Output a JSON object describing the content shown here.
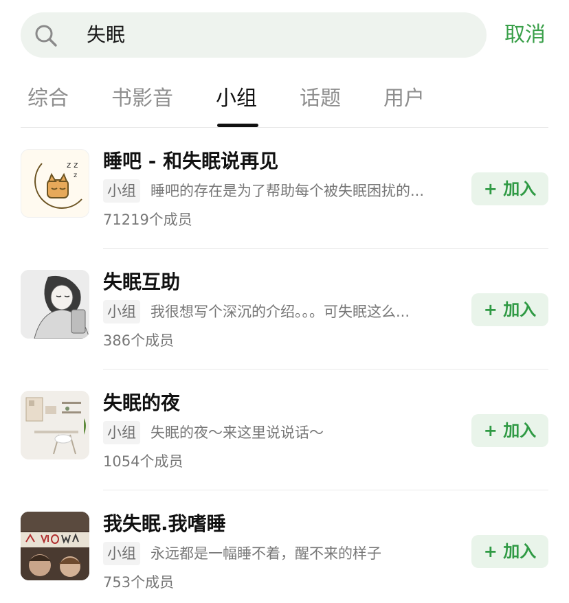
{
  "search": {
    "query": "失眠",
    "cancel_label": "取消"
  },
  "tabs": [
    {
      "label": "综合"
    },
    {
      "label": "书影音"
    },
    {
      "label": "小组"
    },
    {
      "label": "话题"
    },
    {
      "label": "用户"
    }
  ],
  "active_tab": "小组",
  "groups": [
    {
      "title": "睡吧 - 和失眠说再见",
      "tag": "小组",
      "description": "睡吧的存在是为了帮助每个被失眠困扰的...",
      "members": "71219个成员",
      "join_label": "+ 加入"
    },
    {
      "title": "失眠互助",
      "tag": "小组",
      "description": "我很想写个深沉的介绍。。。可失眠这么...",
      "members": "386个成员",
      "join_label": "+ 加入"
    },
    {
      "title": "失眠的夜",
      "tag": "小组",
      "description": "失眠的夜～来这里说说话～",
      "members": "1054个成员",
      "join_label": "+ 加入"
    },
    {
      "title": "我失眠.我嗜睡",
      "tag": "小组",
      "description": "永远都是一幅睡不着，醒不来的样子",
      "members": "753个成员",
      "join_label": "+ 加入"
    }
  ],
  "colors": {
    "accent": "#3aa04a",
    "search_bg": "#eef3ee",
    "join_bg": "#e9f4ea"
  }
}
